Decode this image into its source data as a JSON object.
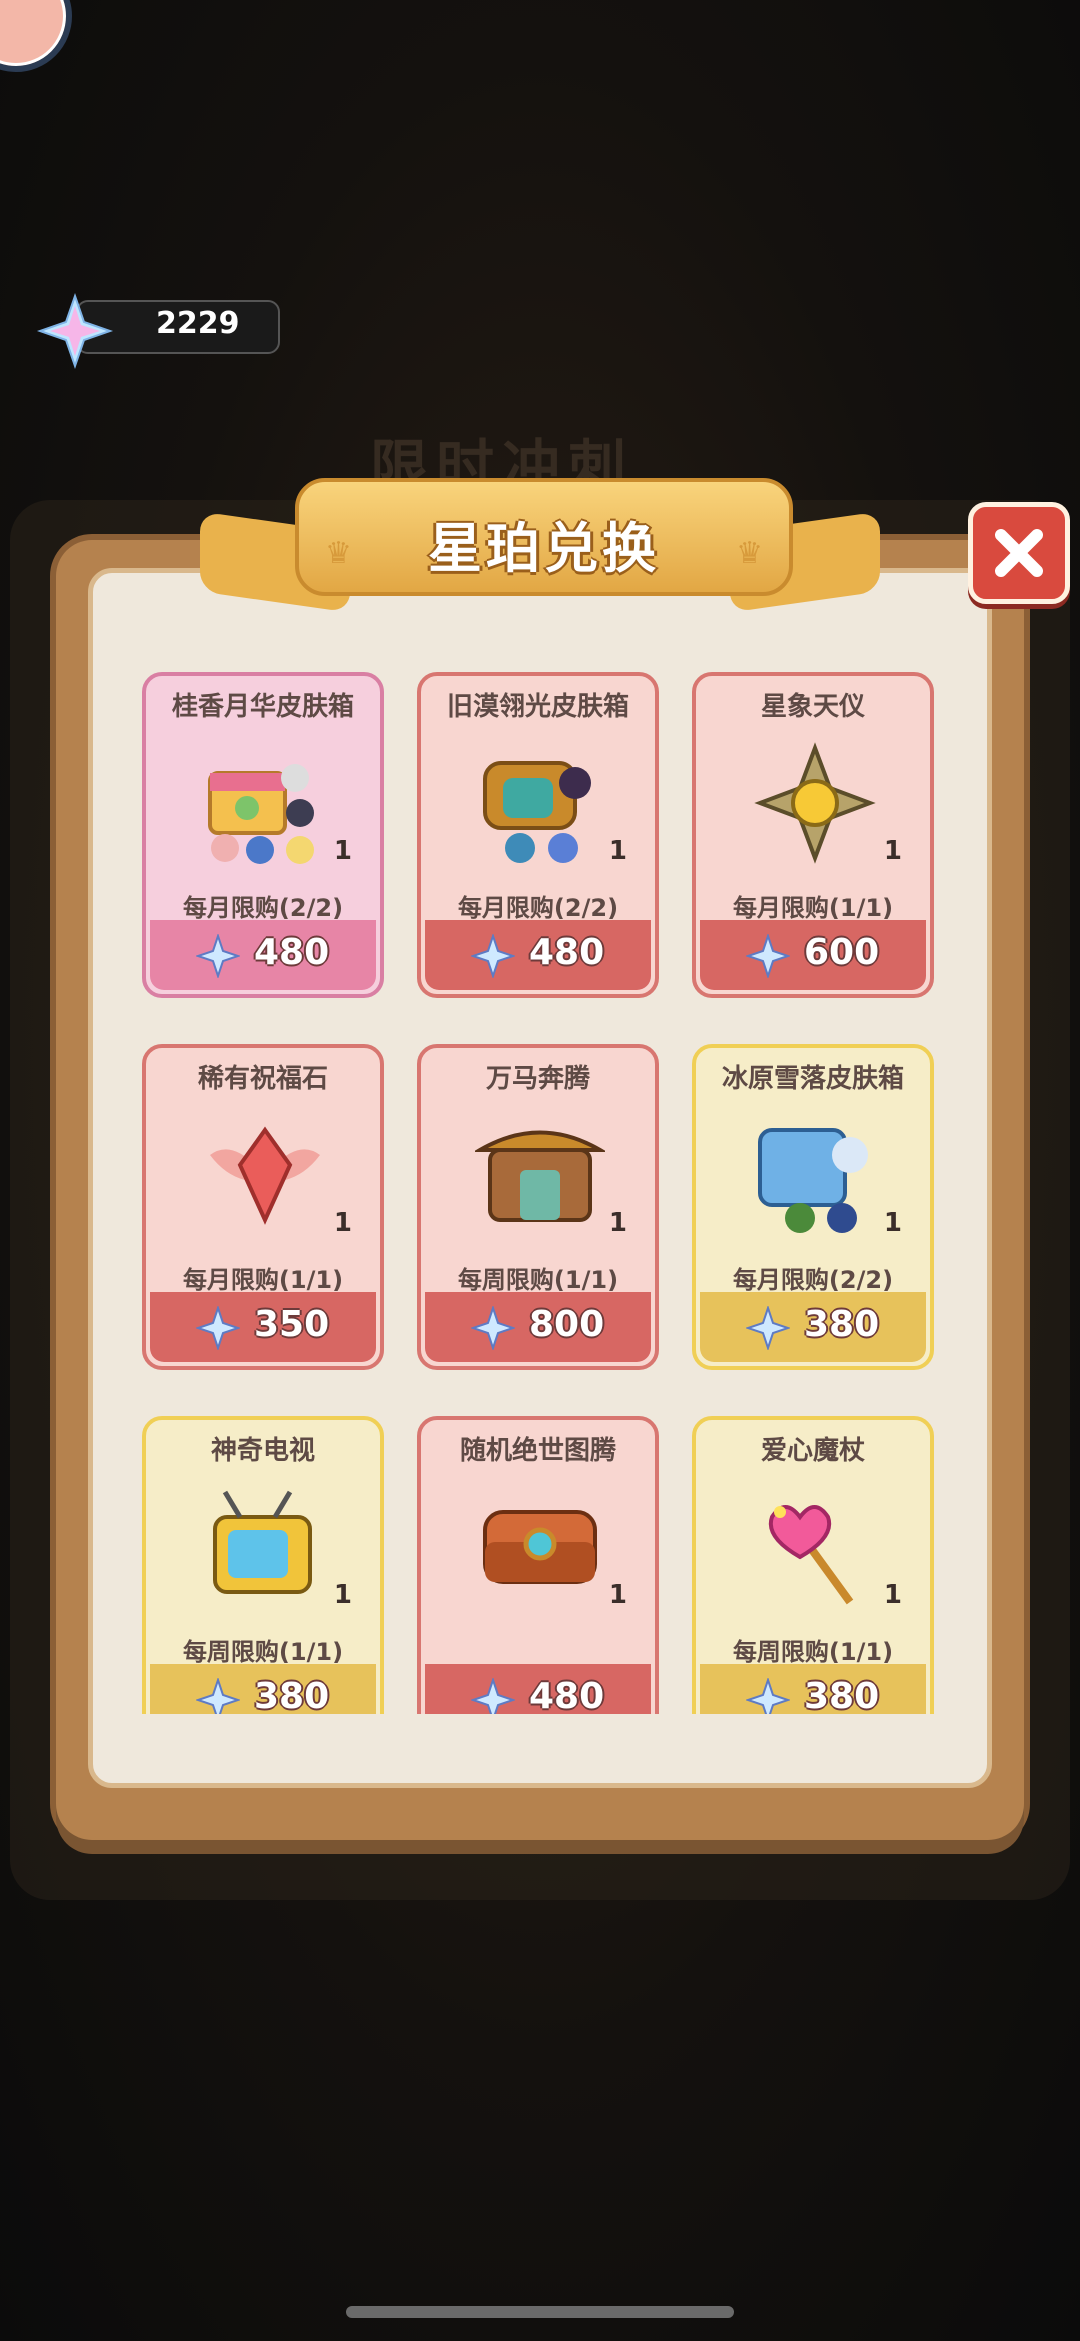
{
  "currency": {
    "icon": "star-gem-icon",
    "value": "2229"
  },
  "background_title": "限时冲刺",
  "dialog": {
    "title": "星珀兑换",
    "close_icon": "close-x-icon"
  },
  "items": [
    {
      "name": "桂香月华皮肤箱",
      "qty": "1",
      "limit": "每月限购(2/2)",
      "price": "480",
      "style": "pink",
      "icon": "skin-box-icon"
    },
    {
      "name": "旧漠翎光皮肤箱",
      "qty": "1",
      "limit": "每月限购(2/2)",
      "price": "480",
      "style": "red",
      "icon": "treasure-chest-icon"
    },
    {
      "name": "星象天仪",
      "qty": "1",
      "limit": "每月限购(1/1)",
      "price": "600",
      "style": "red",
      "icon": "astrolabe-icon"
    },
    {
      "name": "稀有祝福石",
      "qty": "1",
      "limit": "每月限购(1/1)",
      "price": "350",
      "style": "red",
      "icon": "winged-gem-icon"
    },
    {
      "name": "万马奔腾",
      "qty": "1",
      "limit": "每周限购(1/1)",
      "price": "800",
      "style": "red",
      "icon": "gate-icon"
    },
    {
      "name": "冰原雪落皮肤箱",
      "qty": "1",
      "limit": "每月限购(2/2)",
      "price": "380",
      "style": "yellow",
      "icon": "ice-box-icon"
    },
    {
      "name": "神奇电视",
      "qty": "1",
      "limit": "每周限购(1/1)",
      "price": "380",
      "style": "yellow",
      "icon": "tv-icon"
    },
    {
      "name": "随机绝世图腾",
      "qty": "1",
      "limit": "",
      "price": "480",
      "style": "red",
      "icon": "totem-chest-icon"
    },
    {
      "name": "爱心魔杖",
      "qty": "1",
      "limit": "每周限购(1/1)",
      "price": "380",
      "style": "yellow",
      "icon": "heart-wand-icon"
    }
  ]
}
